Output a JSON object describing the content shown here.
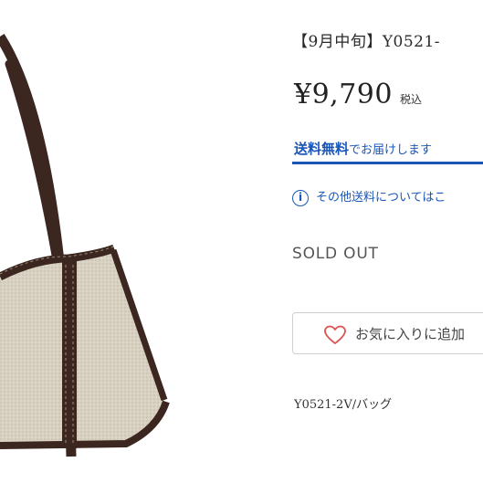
{
  "product": {
    "title": "【9月中旬】Y0521-",
    "price": "¥9,790",
    "tax_label": "税込",
    "shipping_bold": "送料無料",
    "shipping_rest": "でお届けします",
    "shipping_note": "その他送料についてはこ",
    "stock_status": "SOLD OUT",
    "favorite_label": "お気に入りに追加",
    "sku": "Y0521-2V/バッグ"
  },
  "colors": {
    "accent_blue": "#1a56b8",
    "heart_red": "#d9534f",
    "canvas_beige": "#d8d1c2",
    "leather_brown": "#3b2620"
  },
  "icons": {
    "info": "info-circle-icon",
    "favorite": "heart-outline-icon"
  }
}
